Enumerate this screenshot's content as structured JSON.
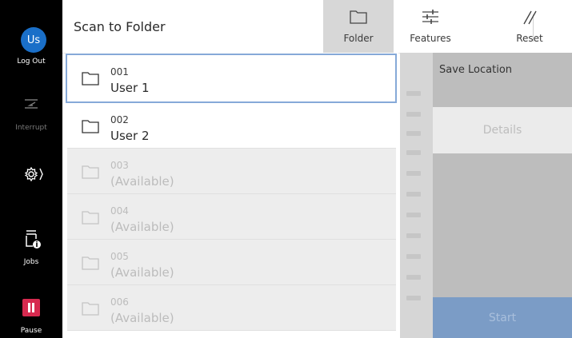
{
  "rail": {
    "avatar_initials": "Us",
    "logout_label": "Log Out",
    "interrupt_label": "Interrupt",
    "jobs_label": "Jobs",
    "pause_label": "Pause",
    "pause_color": "#d62a4f"
  },
  "header": {
    "title": "Scan to Folder",
    "folder_label": "Folder",
    "features_label": "Features",
    "reset_label": "Reset"
  },
  "folders": [
    {
      "number": "001",
      "name": "User 1",
      "state": "selected"
    },
    {
      "number": "002",
      "name": "User 2",
      "state": "normal"
    },
    {
      "number": "003",
      "name": "(Available)",
      "state": "available"
    },
    {
      "number": "004",
      "name": "(Available)",
      "state": "available"
    },
    {
      "number": "005",
      "name": "(Available)",
      "state": "available"
    },
    {
      "number": "006",
      "name": "(Available)",
      "state": "available"
    }
  ],
  "right_panel": {
    "save_location_label": "Save Location",
    "details_label": "Details",
    "start_label": "Start",
    "start_color": "#7b9cc6"
  },
  "icons": {
    "folder": "folder-icon",
    "features": "sliders-icon",
    "reset": "double-slash-icon",
    "interrupt": "interrupt-icon",
    "settings": "gear-icon",
    "jobs": "printer-info-icon",
    "pause": "pause-icon"
  }
}
